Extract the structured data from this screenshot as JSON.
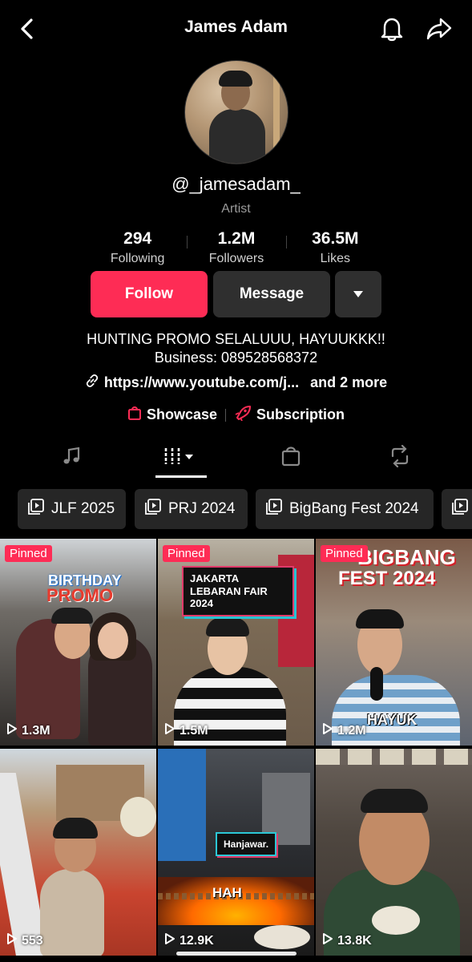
{
  "header": {
    "title": "James Adam",
    "back_icon": "chevron-left-icon",
    "bell_icon": "bell-icon",
    "share_icon": "share-arrow-icon"
  },
  "profile": {
    "handle": "@_jamesadam_",
    "role": "Artist",
    "stats": [
      {
        "value": "294",
        "label": "Following"
      },
      {
        "value": "1.2M",
        "label": "Followers"
      },
      {
        "value": "36.5M",
        "label": "Likes"
      }
    ],
    "buttons": {
      "follow": "Follow",
      "message": "Message"
    },
    "bio_line1": "HUNTING PROMO SELALUUU, HAYUUKKK!!",
    "bio_line2": "Business: 089528568372",
    "link_text": "https://www.youtube.com/j...",
    "link_more": "and 2 more",
    "showcase": "Showcase",
    "subscription": "Subscription"
  },
  "tabs": [
    "music-note-icon",
    "videos-grid-icon",
    "shopping-bag-icon",
    "repost-icon"
  ],
  "playlists": [
    "JLF 2025",
    "PRJ 2024",
    "BigBang Fest 2024"
  ],
  "videos": [
    {
      "views": "1.3M",
      "pinned": "Pinned",
      "caption1": "BIRTHDAY",
      "caption2": "PROMO"
    },
    {
      "views": "1.5M",
      "pinned": "Pinned",
      "caption": "JAKARTA LEBARAN FAIR 2024"
    },
    {
      "views": "1.2M",
      "pinned": "Pinned",
      "caption1": "BIGBANG",
      "caption2": "FEST 2024",
      "sub": "HAYUK"
    },
    {
      "views": "553"
    },
    {
      "views": "12.9K",
      "caption": "Hanjawar.",
      "sub": "HAH"
    },
    {
      "views": "13.8K"
    }
  ],
  "colors": {
    "accent": "#fe2c55",
    "background": "#000000",
    "button_dark": "#2f2f2f"
  }
}
